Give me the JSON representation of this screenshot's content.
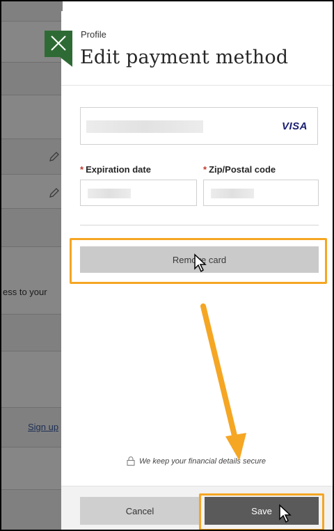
{
  "background": {
    "text_fragment": "ess to your",
    "link_fragment": "Sign up",
    "edit_icon": "pencil-icon"
  },
  "panel": {
    "close_icon": "close-icon",
    "breadcrumb": "Profile",
    "title": "Edit payment method",
    "card": {
      "brand": "VISA",
      "number_value": ""
    },
    "expiration": {
      "label": "Expiration date",
      "required_mark": "*",
      "value": ""
    },
    "zip": {
      "label": "Zip/Postal code",
      "required_mark": "*",
      "value": ""
    },
    "remove_card_label": "Remove card",
    "secure_note": "We keep your financial details secure",
    "lock_icon": "lock-icon",
    "footer": {
      "cancel_label": "Cancel",
      "save_label": "Save"
    }
  },
  "colors": {
    "accent_green": "#2e6b34",
    "highlight": "#f5a623",
    "save_bg": "#5a5a5a",
    "remove_bg": "#cacaca"
  }
}
